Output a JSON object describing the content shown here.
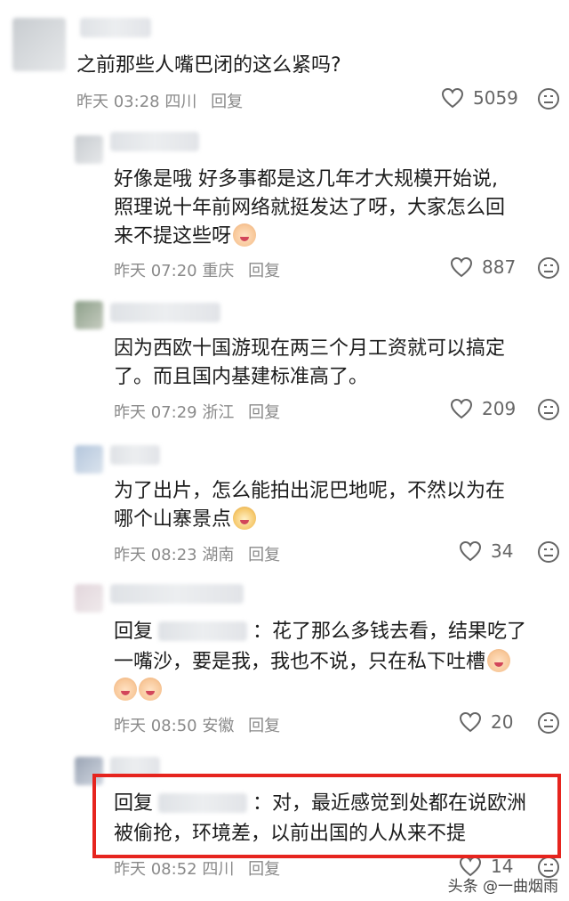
{
  "comments": [
    {
      "text_lines": [
        "之前那些人嘴巴闭的这么紧吗?"
      ],
      "time": "昨天 03:28",
      "location": "四川",
      "reply_label": "回复",
      "likes": "5059"
    },
    {
      "text_lines": [
        "好像是哦 好多事都是这几年才大规模开始说,",
        "照理说十年前网络就挺发达了呀，大家怎么回",
        "来不提这些呀"
      ],
      "time": "昨天 07:20",
      "location": "重庆",
      "reply_label": "回复",
      "likes": "887"
    },
    {
      "text_lines": [
        "因为西欧十国游现在两三个月工资就可以搞定",
        "了。而且国内基建标准高了。"
      ],
      "time": "昨天 07:29",
      "location": "浙江",
      "reply_label": "回复",
      "likes": "209"
    },
    {
      "text_lines": [
        "为了出片，怎么能拍出泥巴地呢，不然以为在",
        "哪个山寨景点"
      ],
      "time": "昨天 08:23",
      "location": "湖南",
      "reply_label": "回复",
      "likes": "34"
    },
    {
      "reply_prefix": "回复",
      "text_lines": [
        "：花了那么多钱去看，结果吃了",
        "一嘴沙，要是我，我也不说，只在私下吐槽"
      ],
      "time": "昨天 08:50",
      "location": "安徽",
      "reply_label": "回复",
      "likes": "20"
    },
    {
      "reply_prefix": "回复",
      "text_lines": [
        "：对，最近感觉到处都在说欧洲",
        "被偷抢，环境差，以前出国的人从来不提"
      ],
      "time": "昨天 08:52",
      "location": "四川",
      "reply_label": "回复",
      "likes": "14"
    }
  ],
  "watermark": "头条 @一曲烟雨",
  "colors": {
    "highlight_border": "#e6241e",
    "meta_text": "#8a8a8a"
  }
}
